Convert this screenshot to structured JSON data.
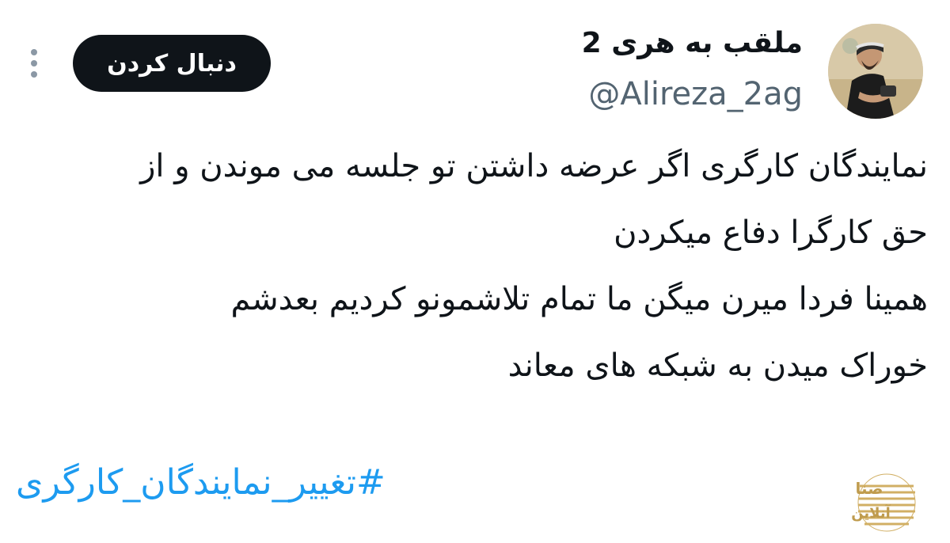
{
  "author": {
    "display_name": "ملقب به هری 2",
    "handle": "@Alireza_2ag",
    "avatar_icon": "user-photo-avatar"
  },
  "actions": {
    "follow_label": "دنبال کردن",
    "more_icon": "more-vertical-icon"
  },
  "tweet": {
    "lines": [
      "نمایندگان کارگری اگر عرضه داشتن تو جلسه می موندن و از",
      "حق کارگرا دفاع میکردن",
      "همینا فردا میرن میگن ما تمام تلاشمونو کردیم بعدشم",
      "خوراک میدن به شبکه های معاند"
    ],
    "hashtag": "#تغییر_نمایندگان_کارگری"
  },
  "watermark": {
    "text_line1": "صنا",
    "text_line2": "آنلاین",
    "brand_color": "#c9a24a"
  },
  "colors": {
    "text": "#0f1419",
    "secondary": "#536471",
    "hashtag": "#1d9bf0",
    "button_bg": "#0f1419"
  }
}
